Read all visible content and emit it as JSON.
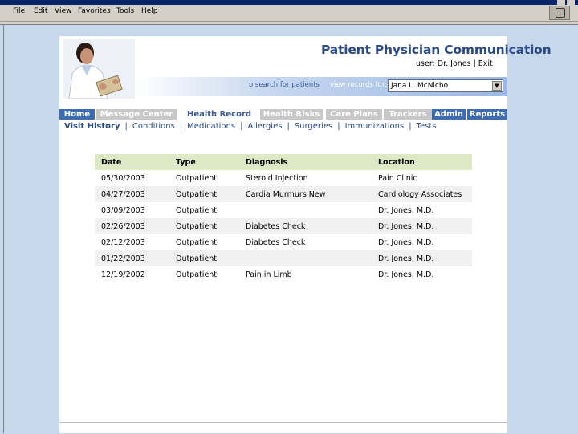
{
  "window": {
    "menu": [
      "File",
      "Edit",
      "View",
      "Favorites",
      "Tools",
      "Help"
    ]
  },
  "header": {
    "brand_title": "Patient Physician Communication",
    "user_label": "user: Dr. Jones",
    "exit_label": "Exit",
    "search_link": "o search for patients",
    "view_records_label": "view records for:",
    "patient_selected": "Jana L. McNicho"
  },
  "tabs": [
    {
      "label": "Home",
      "style": "blue"
    },
    {
      "label": "Message Center",
      "style": "gray"
    },
    {
      "label": "Health Record",
      "style": "active"
    },
    {
      "label": "Health Risks",
      "style": "gray"
    },
    {
      "label": "Care Plans",
      "style": "gray"
    },
    {
      "label": "Trackers",
      "style": "gray"
    },
    {
      "label": "Admin",
      "style": "blue"
    },
    {
      "label": "Reports",
      "style": "blue"
    }
  ],
  "subnav": [
    "Visit History",
    "Conditions",
    "Medications",
    "Allergies",
    "Surgeries",
    "Immunizations",
    "Tests"
  ],
  "table": {
    "headers": [
      "Date",
      "Type",
      "Diagnosis",
      "Location"
    ],
    "rows": [
      [
        "05/30/2003",
        "Outpatient",
        "Steroid Injection",
        "Pain Clinic"
      ],
      [
        "04/27/2003",
        "Outpatient",
        "Cardia Murmurs New",
        "Cardiology Associates"
      ],
      [
        "03/09/2003",
        "Outpatient",
        "",
        "Dr. Jones, M.D."
      ],
      [
        "02/26/2003",
        "Outpatient",
        "Diabetes Check",
        "Dr. Jones, M.D."
      ],
      [
        "02/12/2003",
        "Outpatient",
        "Diabetes Check",
        "Dr. Jones, M.D."
      ],
      [
        "01/22/2003",
        "Outpatient",
        "",
        "Dr. Jones, M.D."
      ],
      [
        "12/19/2002",
        "Outpatient",
        "Pain in Limb",
        "Dr. Jones, M.D."
      ]
    ]
  },
  "colors": {
    "brand_blue": "#2b4a8a",
    "tab_blue": "#3d6cb5",
    "tab_gray": "#c8c8c8",
    "table_header": "#dce9c4"
  }
}
